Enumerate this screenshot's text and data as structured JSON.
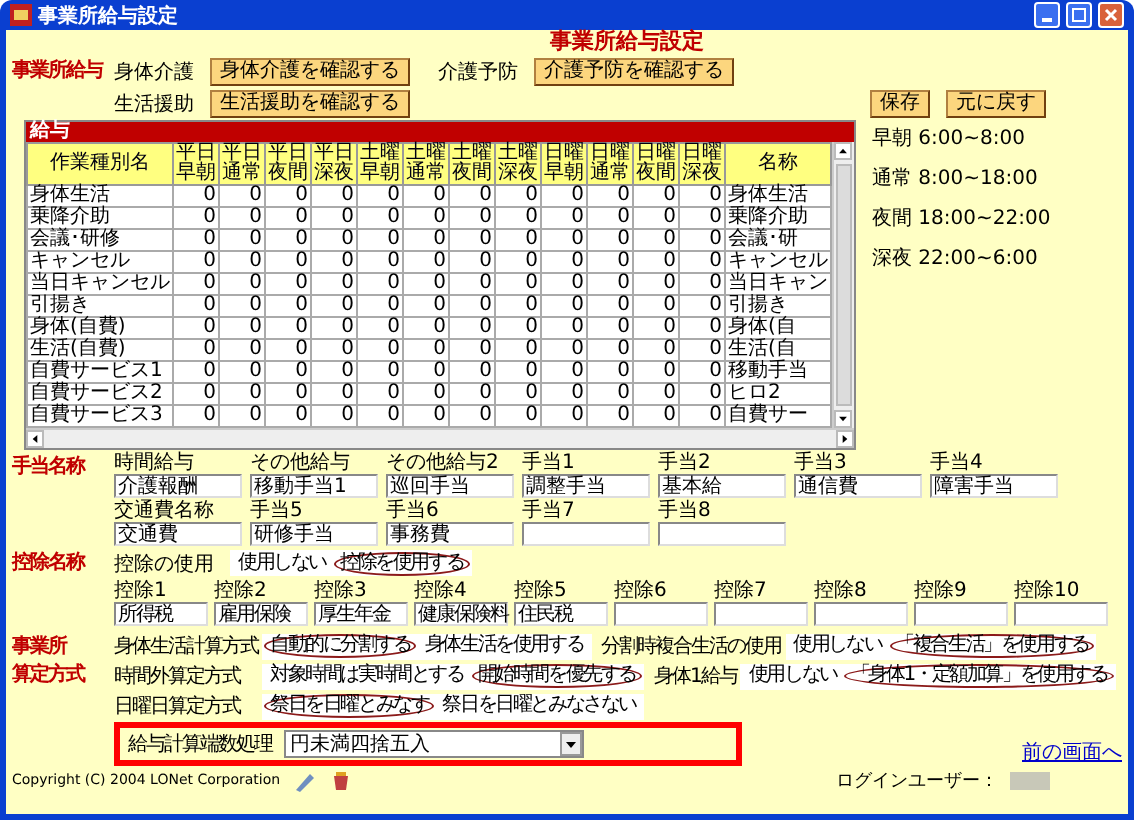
{
  "window": {
    "title": "事業所給与設定"
  },
  "heading": "事業所給与設定",
  "salary": {
    "label": "事業所給与",
    "items": [
      {
        "label": "身体介護",
        "button": "身体介護を確認する"
      },
      {
        "label": "介護予防",
        "button": "介護予防を確認する"
      },
      {
        "label": "生活援助",
        "button": "生活援助を確認する"
      }
    ],
    "actions": [
      "保存",
      "元に戻す"
    ]
  },
  "table": {
    "title": "給与",
    "columns": [
      "作業種別名",
      "平日早朝",
      "平日通常",
      "平日夜間",
      "平日深夜",
      "土曜早朝",
      "土曜通常",
      "土曜夜間",
      "土曜深夜",
      "日曜早朝",
      "日曜通常",
      "日曜夜間",
      "日曜深夜",
      "名称"
    ],
    "rows": [
      [
        "身体生活",
        "0",
        "0",
        "0",
        "0",
        "0",
        "0",
        "0",
        "0",
        "0",
        "0",
        "0",
        "0",
        "身体生活"
      ],
      [
        "乗降介助",
        "0",
        "0",
        "0",
        "0",
        "0",
        "0",
        "0",
        "0",
        "0",
        "0",
        "0",
        "0",
        "乗降介助"
      ],
      [
        "会議･研修",
        "0",
        "0",
        "0",
        "0",
        "0",
        "0",
        "0",
        "0",
        "0",
        "0",
        "0",
        "0",
        "会議･研"
      ],
      [
        "キャンセル",
        "0",
        "0",
        "0",
        "0",
        "0",
        "0",
        "0",
        "0",
        "0",
        "0",
        "0",
        "0",
        "キャンセル"
      ],
      [
        "当日キャンセル",
        "0",
        "0",
        "0",
        "0",
        "0",
        "0",
        "0",
        "0",
        "0",
        "0",
        "0",
        "0",
        "当日キャン"
      ],
      [
        "引揚き",
        "0",
        "0",
        "0",
        "0",
        "0",
        "0",
        "0",
        "0",
        "0",
        "0",
        "0",
        "0",
        "引揚き"
      ],
      [
        "身体(自費)",
        "0",
        "0",
        "0",
        "0",
        "0",
        "0",
        "0",
        "0",
        "0",
        "0",
        "0",
        "0",
        "身体(自"
      ],
      [
        "生活(自費)",
        "0",
        "0",
        "0",
        "0",
        "0",
        "0",
        "0",
        "0",
        "0",
        "0",
        "0",
        "0",
        "生活(自"
      ],
      [
        "自費サービス1",
        "0",
        "0",
        "0",
        "0",
        "0",
        "0",
        "0",
        "0",
        "0",
        "0",
        "0",
        "0",
        "移動手当"
      ],
      [
        "自費サービス2",
        "0",
        "0",
        "0",
        "0",
        "0",
        "0",
        "0",
        "0",
        "0",
        "0",
        "0",
        "0",
        "ヒロ2"
      ],
      [
        "自費サービス3",
        "0",
        "0",
        "0",
        "0",
        "0",
        "0",
        "0",
        "0",
        "0",
        "0",
        "0",
        "0",
        "自費サー"
      ]
    ]
  },
  "legend": [
    "早朝 6:00~8:00",
    "通常 8:00~18:00",
    "夜間 18:00~22:00",
    "深夜 22:00~6:00"
  ],
  "allowance": {
    "label": "手当名称",
    "rows": [
      [
        {
          "label": "時間給与",
          "value": "介護報酬"
        },
        {
          "label": "その他給与",
          "value": "移動手当1"
        },
        {
          "label": "その他給与2",
          "value": "巡回手当"
        },
        {
          "label": "手当1",
          "value": "調整手当"
        },
        {
          "label": "手当2",
          "value": "基本給"
        },
        {
          "label": "手当3",
          "value": "通信費"
        },
        {
          "label": "手当4",
          "value": "障害手当"
        }
      ],
      [
        {
          "label": "交通費名称",
          "value": "交通費"
        },
        {
          "label": "手当5",
          "value": "研修手当"
        },
        {
          "label": "手当6",
          "value": "事務費"
        },
        {
          "label": "手当7"
        },
        {
          "label": "手当8"
        }
      ]
    ]
  },
  "deduction": {
    "label": "控除名称",
    "usage": {
      "label": "控除の使用",
      "options": [
        {
          "text": "使用しない",
          "selected": false
        },
        {
          "text": "控除を使用する",
          "selected": true
        }
      ]
    },
    "fields": [
      {
        "label": "控除1",
        "value": "所得税"
      },
      {
        "label": "控除2",
        "value": "雇用保険"
      },
      {
        "label": "控除3",
        "value": "厚生年金"
      },
      {
        "label": "控除4",
        "value": "健康保険料"
      },
      {
        "label": "控除5",
        "value": "住民税"
      },
      {
        "label": "控除6"
      },
      {
        "label": "控除7"
      },
      {
        "label": "控除8"
      },
      {
        "label": "控除9"
      },
      {
        "label": "控除10"
      }
    ]
  },
  "calc": {
    "label": [
      "事業所",
      "算定方式"
    ],
    "settings": [
      {
        "label": "身体生活計算方式",
        "options": [
          {
            "text": "自動的に分割する",
            "selected": true
          },
          {
            "text": "身体生活を使用する",
            "selected": false
          }
        ]
      },
      {
        "label": "分割時複合生活の使用",
        "options": [
          {
            "text": "使用しない",
            "selected": false
          },
          {
            "text": "「複合生活」を使用する",
            "selected": true
          }
        ]
      },
      {
        "label": "時間外算定方式",
        "options": [
          {
            "text": "対象時間は実時間とする",
            "selected": false
          },
          {
            "text": "開始時間を優先する",
            "selected": true
          }
        ]
      },
      {
        "label": "身体1給与",
        "options": [
          {
            "text": "使用しない",
            "selected": false
          },
          {
            "text": "「身体1・定額加算」を使用する",
            "selected": true
          }
        ]
      },
      {
        "label": "日曜日算定方式",
        "options": [
          {
            "text": "祭日を日曜とみなす",
            "selected": true
          },
          {
            "text": "祭日を日曜とみなさない",
            "selected": false
          }
        ]
      }
    ]
  },
  "rounding": {
    "label": "給与計算端数処理",
    "value": "円未満四捨五入"
  },
  "footer": {
    "copyright": "Copyright (C) 2004 LONet Corporation",
    "back_link": "前の画面へ",
    "login_label": "ログインユーザー："
  }
}
